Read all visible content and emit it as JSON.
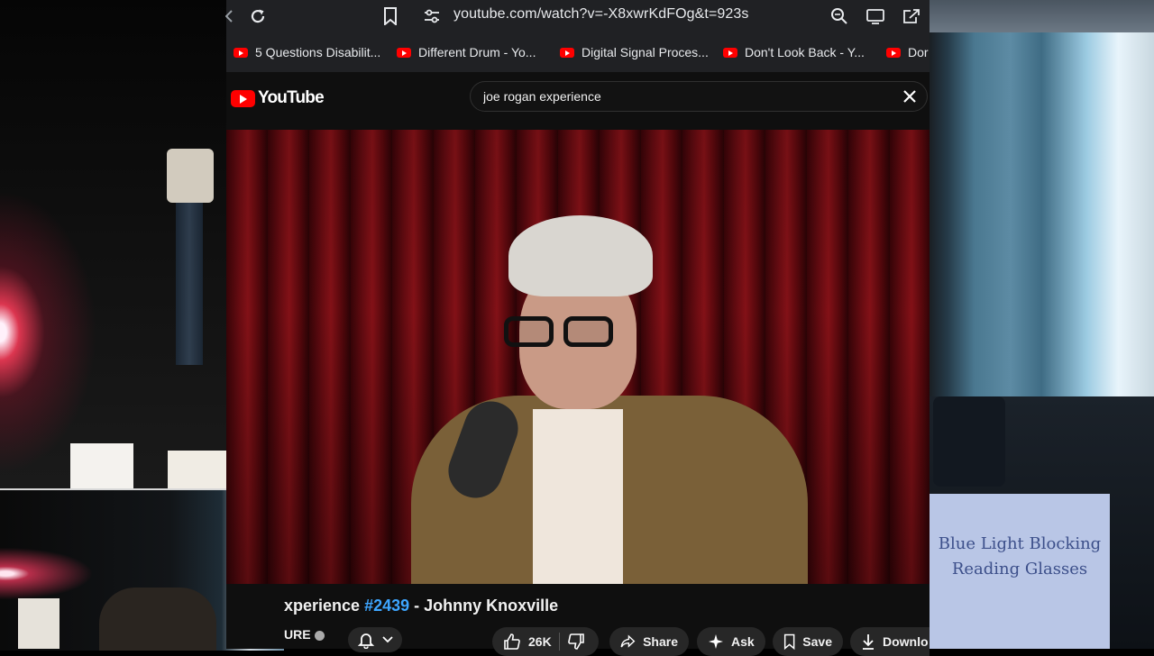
{
  "browser": {
    "url": "youtube.com/watch?v=-X8xwrKdFOg&t=923s",
    "bookmarks": [
      {
        "label": "5 Questions Disabilit..."
      },
      {
        "label": "Different Drum - Yo..."
      },
      {
        "label": "Digital Signal Proces..."
      },
      {
        "label": "Don't Look Back - Y..."
      },
      {
        "label": "Dor"
      }
    ]
  },
  "youtube": {
    "logo_text": "YouTube",
    "search_value": "joe rogan experience",
    "video": {
      "title_prefix": "xperience ",
      "title_tag": "#2439",
      "title_suffix": " - Johnny Knoxville",
      "channel_fragment": "URE",
      "likes": "26K",
      "share_label": "Share",
      "ask_label": "Ask",
      "save_label": "Save",
      "download_label": "Downlo"
    }
  },
  "webcam": {
    "sign_text_line1": "Blue Light Blocking",
    "sign_text_line2": "Reading Glasses"
  },
  "colors": {
    "brand_red": "#ff0000",
    "hashtag_blue": "#3ea6ff",
    "chrome_bar": "#202124",
    "yt_bg": "#0f0f0f"
  }
}
